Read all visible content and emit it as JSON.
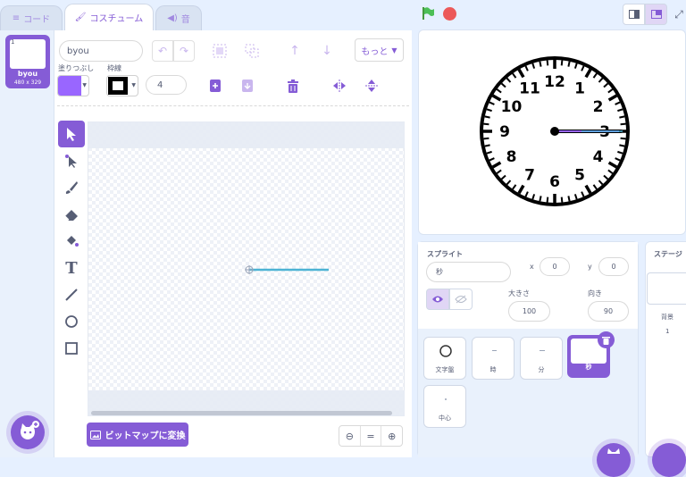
{
  "tabs": [
    {
      "label": "コード"
    },
    {
      "label": "コスチューム"
    },
    {
      "label": "音"
    }
  ],
  "costume": {
    "index": "1",
    "name": "byou",
    "size": "480 x 329"
  },
  "paint_editor": {
    "costume_name_value": "byou",
    "more_label": "もっと",
    "fill_label": "塗りつぶし",
    "stroke_label": "枠線",
    "stroke_width": "4",
    "bitmap_button": "ビットマップに変換",
    "fill_color": "#9966ff",
    "stroke_color": "#000000",
    "line_color": "#4cb3d4",
    "zoom_reset_label": "="
  },
  "stage": {
    "clock_numbers": [
      "12",
      "1",
      "2",
      "3",
      "4",
      "5",
      "6",
      "7",
      "8",
      "9",
      "10",
      "11"
    ]
  },
  "sprite_info": {
    "header": "スプライト",
    "name_value": "秒",
    "x_label": "x",
    "x_value": "0",
    "y_label": "y",
    "y_value": "0",
    "size_label": "大きさ",
    "size_value": "100",
    "direction_label": "向き",
    "direction_value": "90"
  },
  "sprites": [
    {
      "name": "文字盤"
    },
    {
      "name": "時"
    },
    {
      "name": "分"
    },
    {
      "name": "秒"
    },
    {
      "name": "中心"
    }
  ],
  "stage_pane": {
    "header": "ステージ",
    "backdrops_label": "背景",
    "backdrops_count": "1"
  },
  "colors": {
    "accent": "#855cd6",
    "green_flag": "#4cbf56",
    "stop": "#ec5959"
  }
}
